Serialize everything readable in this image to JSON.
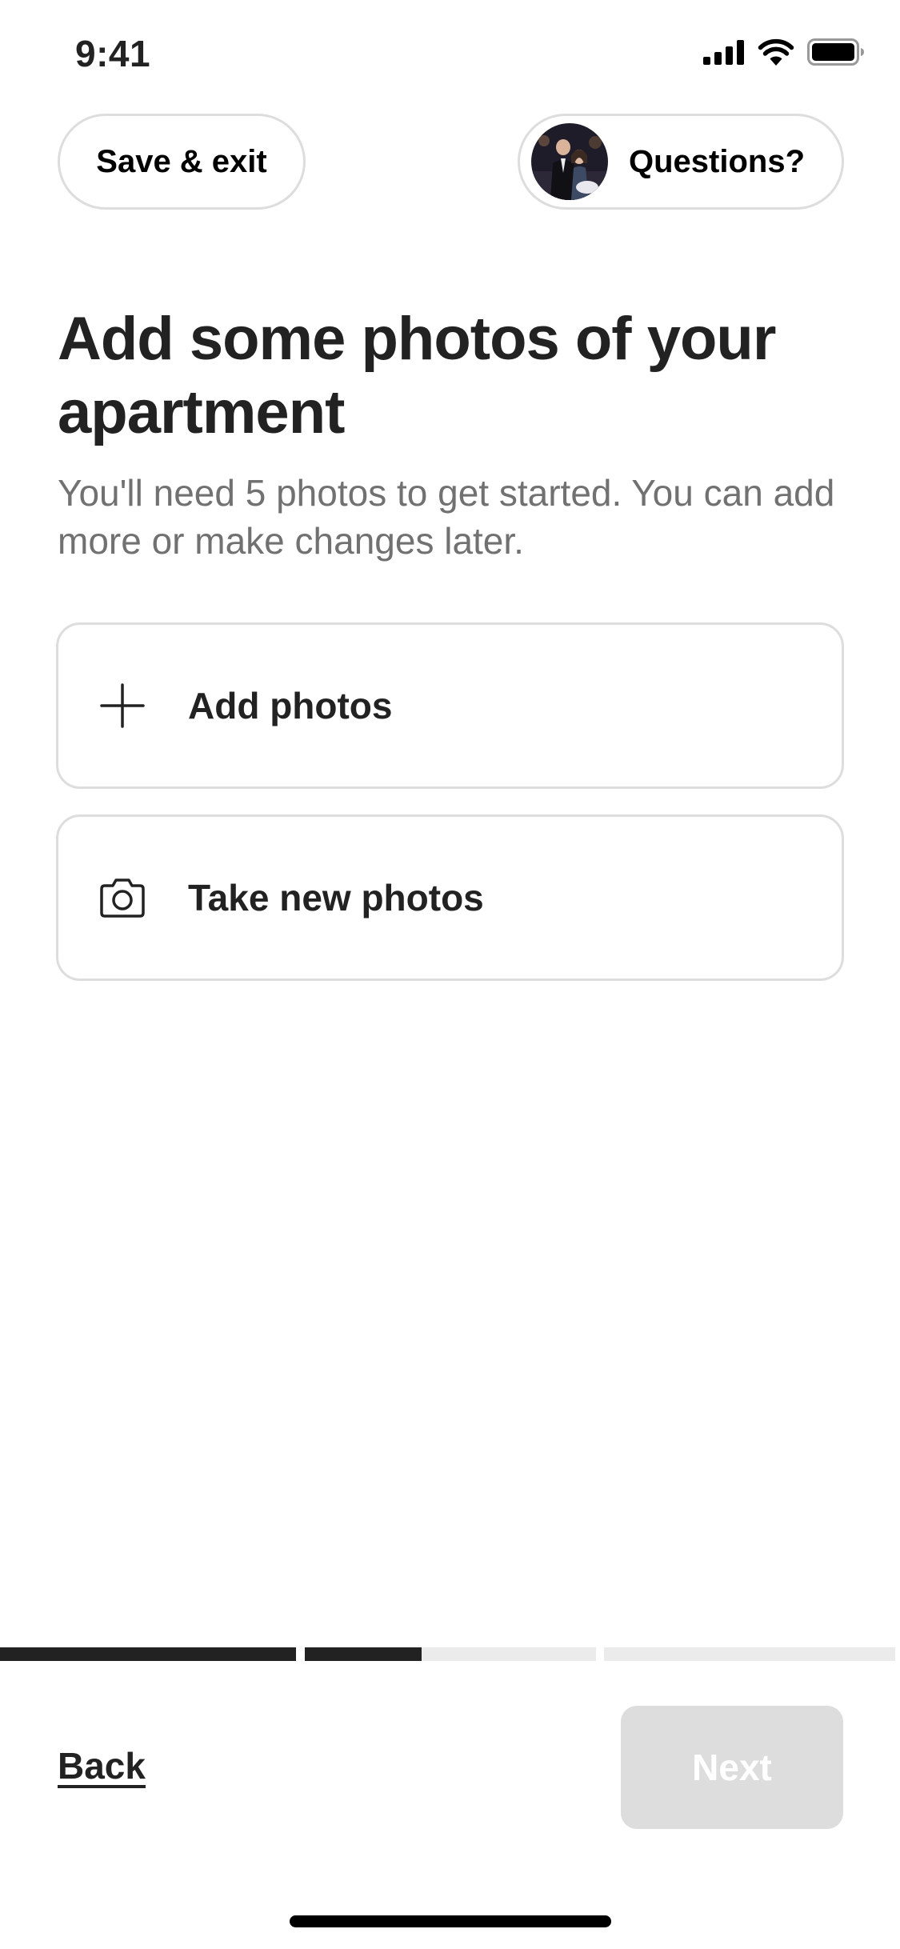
{
  "status_bar": {
    "time": "9:41",
    "icons": [
      "cellular-signal-icon",
      "wifi-icon",
      "battery-icon"
    ]
  },
  "header": {
    "save_exit_label": "Save & exit",
    "questions_label": "Questions?"
  },
  "main": {
    "title": "Add some photos of your apartment",
    "subtitle": "You'll need 5 photos to get started. You can add more or make changes later.",
    "options": [
      {
        "label": "Add photos",
        "icon": "plus-icon"
      },
      {
        "label": "Take new photos",
        "icon": "camera-icon"
      }
    ]
  },
  "progress": {
    "segments": [
      1.0,
      0.4,
      0.0,
      0.0
    ]
  },
  "footer": {
    "back_label": "Back",
    "next_label": "Next",
    "next_enabled": false
  },
  "colors": {
    "text": "#222222",
    "muted_text": "#717171",
    "border": "#dddddd",
    "progress_filled": "#222222",
    "progress_empty": "#ebebeb",
    "disabled_button": "#dddddd"
  }
}
